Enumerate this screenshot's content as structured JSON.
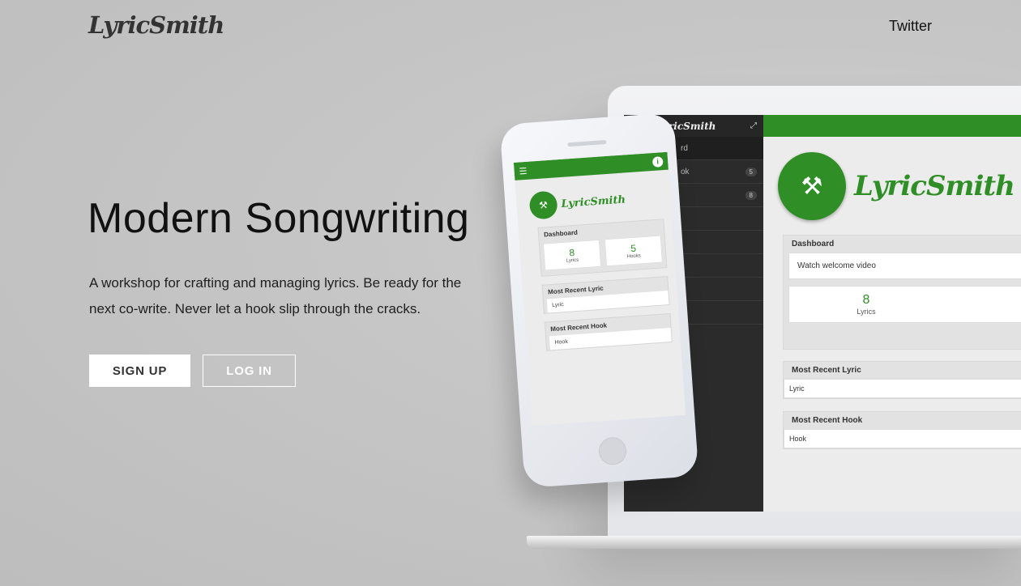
{
  "header": {
    "logo_text": "LyricSmith",
    "nav_twitter": "Twitter"
  },
  "hero": {
    "title": "Modern Songwriting",
    "subtitle": "A workshop for crafting and managing lyrics.  Be ready for the next co-write.  Never let a hook slip through the cracks.",
    "signup_label": "SIGN UP",
    "login_label": "LOG IN"
  },
  "laptop": {
    "brand": "LyricSmith",
    "nav_items": [
      {
        "label": "rd",
        "badge": ""
      },
      {
        "label": "ok",
        "badge": "5"
      },
      {
        "label": "",
        "badge": "8"
      }
    ],
    "logo_text": "LyricSmith",
    "dashboard_title": "Dashboard",
    "welcome_video": "Watch welcome video",
    "lyrics_count": "8",
    "lyrics_label": "Lyrics",
    "recent_lyric_title": "Most Recent Lyric",
    "recent_lyric_value": "Lyric",
    "recent_hook_title": "Most Recent Hook",
    "recent_hook_value": "Hook"
  },
  "phone": {
    "logo_text": "LyricSmith",
    "dashboard_title": "Dashboard",
    "lyrics_count": "8",
    "lyrics_label": "Lyrics",
    "hooks_count": "5",
    "hooks_label": "Hooks",
    "recent_lyric_title": "Most Recent Lyric",
    "recent_lyric_value": "Lyric",
    "recent_hook_title": "Most Recent Hook",
    "recent_hook_value": "Hook"
  },
  "colors": {
    "brand_green": "#2f8f26",
    "background": "#c6c6c6"
  }
}
